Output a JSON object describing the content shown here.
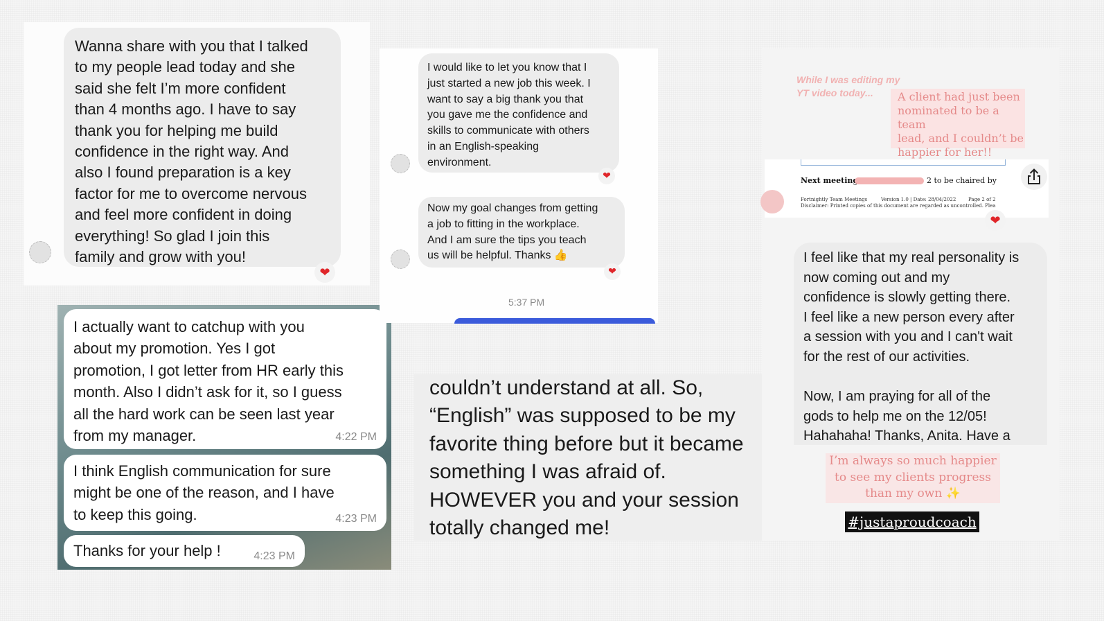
{
  "card1": {
    "message": "Wanna share with you that I talked\nto my people lead today and she\nsaid she felt I’m more confident\nthan 4 months ago. I have to say\nthank you for helping me build\nconfidence in the right way. And\nalso I found preparation is a key\nfactor for me to overcome nervous\nand feel more confident in doing\neverything! So glad I join this\nfamily and grow with you!",
    "reaction": "❤"
  },
  "card2": {
    "messages": [
      {
        "text": "I actually want to catchup with you\nabout my promotion. Yes I got\npromotion, I got letter from HR early this\nmonth. Also I didn’t ask for it, so I guess\nall the hard work can be seen last year\nfrom my manager.",
        "time": "4:22 PM"
      },
      {
        "text": "I think English communication for sure\nmight be one of the reason, and I have\nto keep this going.",
        "time": "4:23 PM"
      },
      {
        "text": "Thanks for your help !",
        "time": "4:23 PM"
      }
    ]
  },
  "card3": {
    "messages": [
      {
        "text": "I would like to let you know that I\njust started a new job this week. I\nwant to say a big thank you that\nyou gave me the confidence and\nskills to communicate with others\nin an English-speaking\nenvironment.",
        "reaction": "❤"
      },
      {
        "text": "Now my goal changes from getting\na job to fitting in the workplace.\nAnd I am sure the tips you teach\nus will be helpful. Thanks 👍",
        "reaction": "❤"
      }
    ],
    "timestamp": "5:37 PM"
  },
  "card4": {
    "text": "couldn’t understand at all. So,\n“English” was supposed to be my\nfavorite thing before but it became\nsomething I was afraid of.\nHOWEVER you and your session\ntotally changed me!"
  },
  "card5": {
    "caption_top": "While I was editing my\nYT video today...",
    "caption_note": "A client had just been\nnominated to be a team\nlead, and I couldn’t be\nhappier for her!!",
    "doc_next_meeting": "Next meeting:",
    "doc_chaired": "2 to be chaired by",
    "doc_footer_left": "Fortnightly Team Meetings",
    "doc_footer_version": "Version 1.0 | Date: 28/04/2022",
    "doc_footer_page": "Page 2 of 2",
    "doc_disclaimer": "Disclaimer:  Printed copies of this document are regarded as uncontrolled.  Plea",
    "reaction": "❤",
    "message": "I feel like that my real personality is\nnow coming out and my\nconfidence is slowly getting there.\nI feel like a new person every after\na session with you and I can't wait\nfor the rest of our activities.\n\nNow, I am praying for all of the\ngods to help me on the 12/05!\nHahahaha! Thanks, Anita. Have a",
    "caption_bottom": "I’m always so much happier\nto see my clients progress\nthan my own ✨",
    "hashtag": "#justaproudcoach"
  },
  "colors": {
    "bubble_gray": "#ececec",
    "heart_red": "#e0262a",
    "caption_pink": "#e58a8a",
    "note_pink_bg": "#fbe3e3",
    "send_bar_blue": "#3b5bdb",
    "hashtag_bg": "#111111"
  },
  "icons": [
    "share-icon",
    "heart-icon",
    "thumbs-up-icon",
    "sparkle-icon"
  ]
}
